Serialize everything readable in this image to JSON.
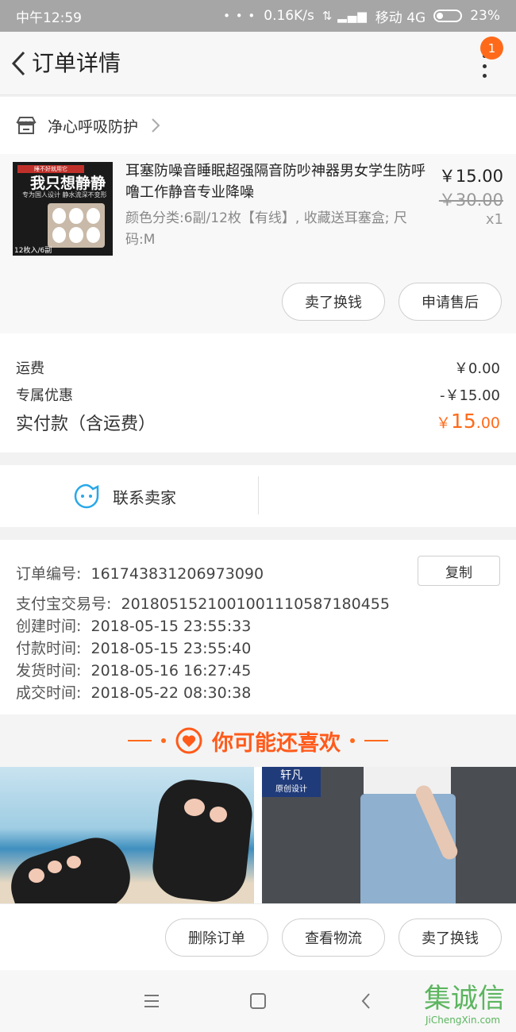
{
  "status_bar": {
    "time": "中午12:59",
    "network_speed": "0.16K/s",
    "carrier": "移动 4G",
    "battery": "23%"
  },
  "header": {
    "title": "订单详情",
    "badge_count": "1"
  },
  "shop": {
    "name": "净心呼吸防护"
  },
  "item": {
    "title": "耳塞防噪音睡眠超强隔音防吵神器男女学生防呼噜工作静音专业降噪",
    "spec": "颜色分类:6副/12枚【有线】, 收藏送耳塞盒; 尺码:M",
    "price": "￥15.00",
    "original_price": "￥30.00",
    "quantity": "x1",
    "thumb_banner": "睡不好就用它",
    "thumb_headline": "我只想静静",
    "thumb_tagline": "专为国人设计  静水流深不变形",
    "thumb_footer": "12枚入/6副",
    "sell_label": "卖了换钱",
    "after_sale_label": "申请售后"
  },
  "fees": {
    "shipping_label": "运费",
    "shipping_value": "￥0.00",
    "discount_label": "专属优惠",
    "discount_value": "-￥15.00",
    "total_label": "实付款（含运费）",
    "total_currency": "￥",
    "total_int": "15",
    "total_dec": ".00"
  },
  "contact": {
    "label": "联系卖家"
  },
  "order_info": {
    "order_no_label": "订单编号:",
    "order_no": "161743831206973090",
    "copy_label": "复制",
    "alipay_label": "支付宝交易号:",
    "alipay_no": "2018051521001001110587180455",
    "created_label": "创建时间:",
    "created": "2018-05-15 23:55:33",
    "paid_label": "付款时间:",
    "paid": "2018-05-15 23:55:40",
    "shipped_label": "发货时间:",
    "shipped": "2018-05-16 16:27:45",
    "completed_label": "成交时间:",
    "completed": "2018-05-22 08:30:38"
  },
  "recommend": {
    "title": "你可能还喜欢",
    "product2_brand": "轩凡",
    "product2_brand_sub": "原创设计"
  },
  "actions": {
    "delete": "删除订单",
    "logistics": "查看物流",
    "sell": "卖了换钱"
  },
  "watermark": {
    "main": "集诚信",
    "sub": "JiChengXin.com"
  },
  "colors": {
    "accent": "#ff6a1a",
    "status_bar": "#a6a6a6"
  }
}
